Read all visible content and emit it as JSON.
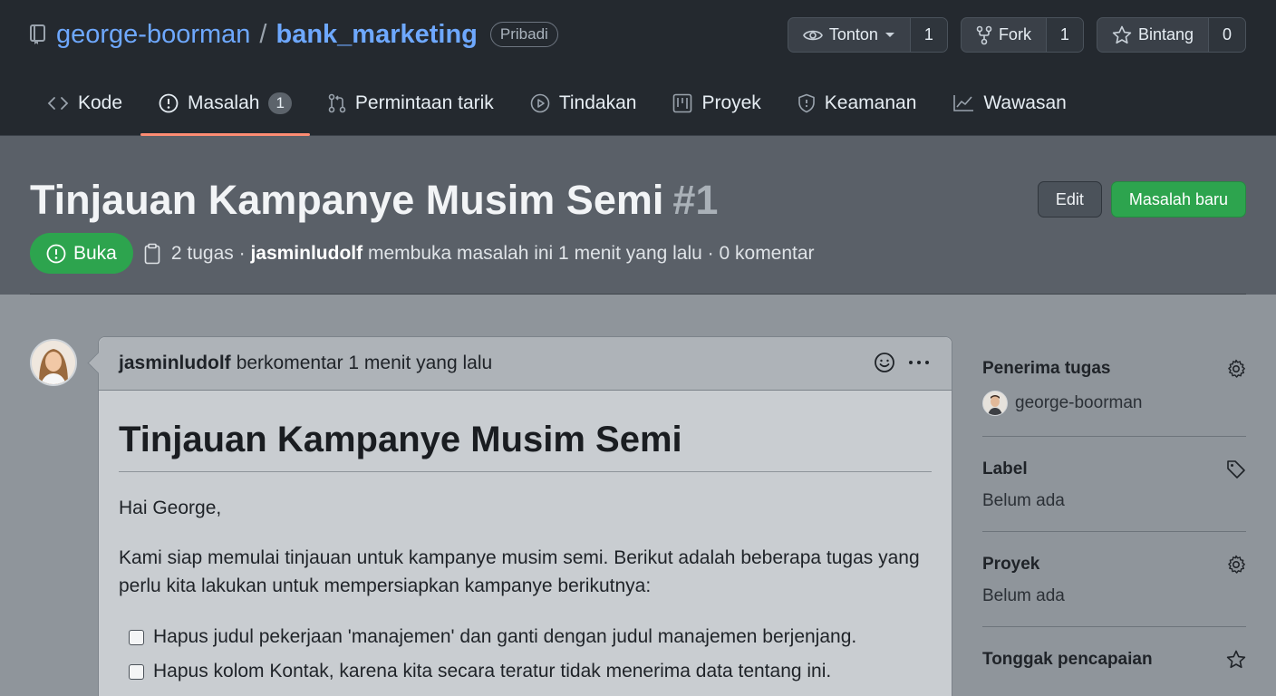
{
  "repo": {
    "owner": "george-boorman",
    "separator": "/",
    "name": "bank_marketing",
    "visibility": "Pribadi"
  },
  "repo_actions": {
    "watch": {
      "label": "Tonton",
      "count": "1"
    },
    "fork": {
      "label": "Fork",
      "count": "1"
    },
    "star": {
      "label": "Bintang",
      "count": "0"
    }
  },
  "tabs": [
    {
      "label": "Kode",
      "icon": "code-icon"
    },
    {
      "label": "Masalah",
      "icon": "issue-icon",
      "count": "1",
      "active": true
    },
    {
      "label": "Permintaan tarik",
      "icon": "pull-request-icon"
    },
    {
      "label": "Tindakan",
      "icon": "play-icon"
    },
    {
      "label": "Proyek",
      "icon": "project-icon"
    },
    {
      "label": "Keamanan",
      "icon": "shield-icon"
    },
    {
      "label": "Wawasan",
      "icon": "graph-icon"
    }
  ],
  "issue": {
    "title": "Tinjauan Kampanye Musim Semi",
    "number": "#1",
    "state": "Buka",
    "tasks": "2 tugas",
    "author": "jasminludolf",
    "opened_text": "membuka masalah ini 1 menit yang lalu",
    "comments": "0 komentar",
    "edit_label": "Edit",
    "new_label": "Masalah baru"
  },
  "comment": {
    "author": "jasminludolf",
    "meta": "berkomentar 1 menit yang lalu",
    "heading": "Tinjauan Kampanye Musim Semi",
    "greeting": "Hai George,",
    "paragraph": "Kami siap memulai tinjauan untuk kampanye musim semi. Berikut adalah beberapa tugas yang perlu kita lakukan untuk mempersiapkan kampanye berikutnya:",
    "tasks": [
      "Hapus judul pekerjaan 'manajemen' dan ganti dengan judul manajemen berjenjang.",
      "Hapus kolom Kontak, karena kita secara teratur tidak menerima data tentang ini."
    ]
  },
  "sidebar": {
    "assignees": {
      "title": "Penerima tugas",
      "value": "george-boorman"
    },
    "labels": {
      "title": "Label",
      "value": "Belum ada"
    },
    "projects": {
      "title": "Proyek",
      "value": "Belum ada"
    },
    "milestone": {
      "title": "Tonggak pencapaian"
    }
  },
  "colors": {
    "header_bg": "#24292f",
    "link": "#6ea8fe",
    "open_green": "#2da44e",
    "active_tab_underline": "#fd8c73"
  }
}
